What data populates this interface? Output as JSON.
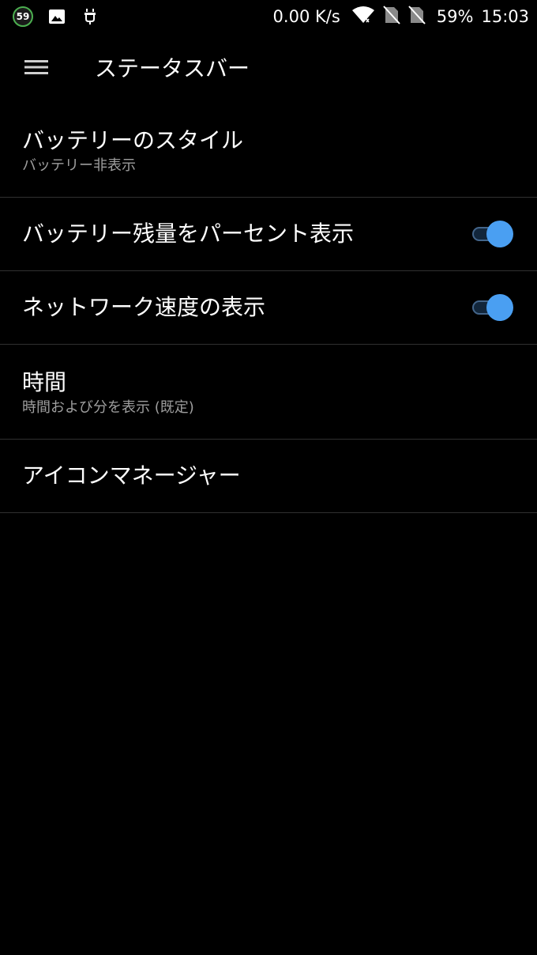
{
  "status_bar": {
    "notification_badge": "59",
    "network_speed": "0.00 K/s",
    "battery_percent": "59%",
    "time": "15:03",
    "icons": [
      "image-icon",
      "usb-debug-icon",
      "wifi-icon",
      "no-sim-icon",
      "no-sim-icon"
    ]
  },
  "app_bar": {
    "title": "ステータスバー",
    "menu_icon": "hamburger-menu-icon"
  },
  "settings": {
    "battery_style": {
      "title": "バッテリーのスタイル",
      "summary": "バッテリー非表示"
    },
    "battery_percent": {
      "title": "バッテリー残量をパーセント表示",
      "enabled": true
    },
    "network_speed": {
      "title": "ネットワーク速度の表示",
      "enabled": true
    },
    "clock": {
      "title": "時間",
      "summary": "時間および分を表示 (既定)"
    },
    "icon_manager": {
      "title": "アイコンマネージャー"
    }
  },
  "colors": {
    "background": "#000000",
    "text_primary": "#ffffff",
    "text_secondary": "#9e9e9e",
    "divider": "#303030",
    "accent": "#4a9ff2",
    "badge_ring": "#4caf50"
  }
}
